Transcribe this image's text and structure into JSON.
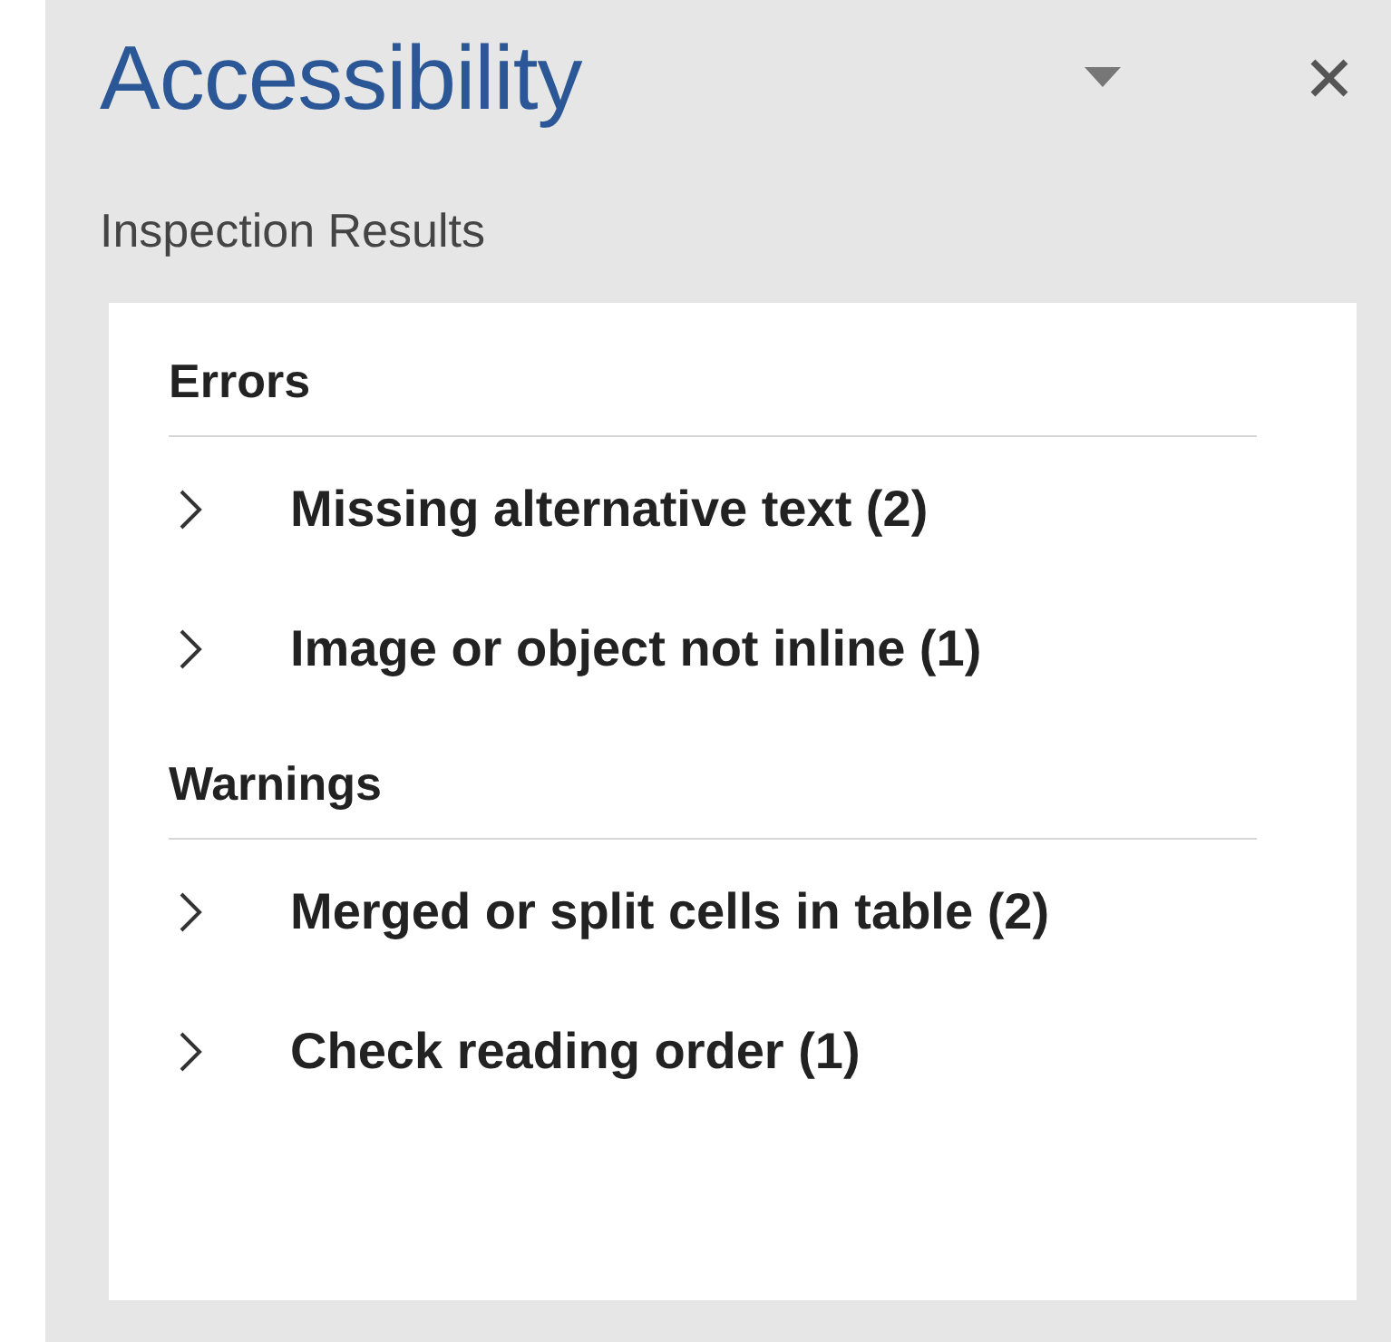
{
  "pane": {
    "title": "Accessibility",
    "subtitle": "Inspection Results"
  },
  "sections": [
    {
      "heading": "Errors",
      "items": [
        {
          "label": "Missing alternative text (2)",
          "expanded": false
        },
        {
          "label": "Image or object not inline (1)",
          "expanded": false
        }
      ]
    },
    {
      "heading": "Warnings",
      "items": [
        {
          "label": "Merged or split cells in table (2)",
          "expanded": false
        },
        {
          "label": "Check reading order (1)",
          "expanded": false
        }
      ]
    }
  ]
}
